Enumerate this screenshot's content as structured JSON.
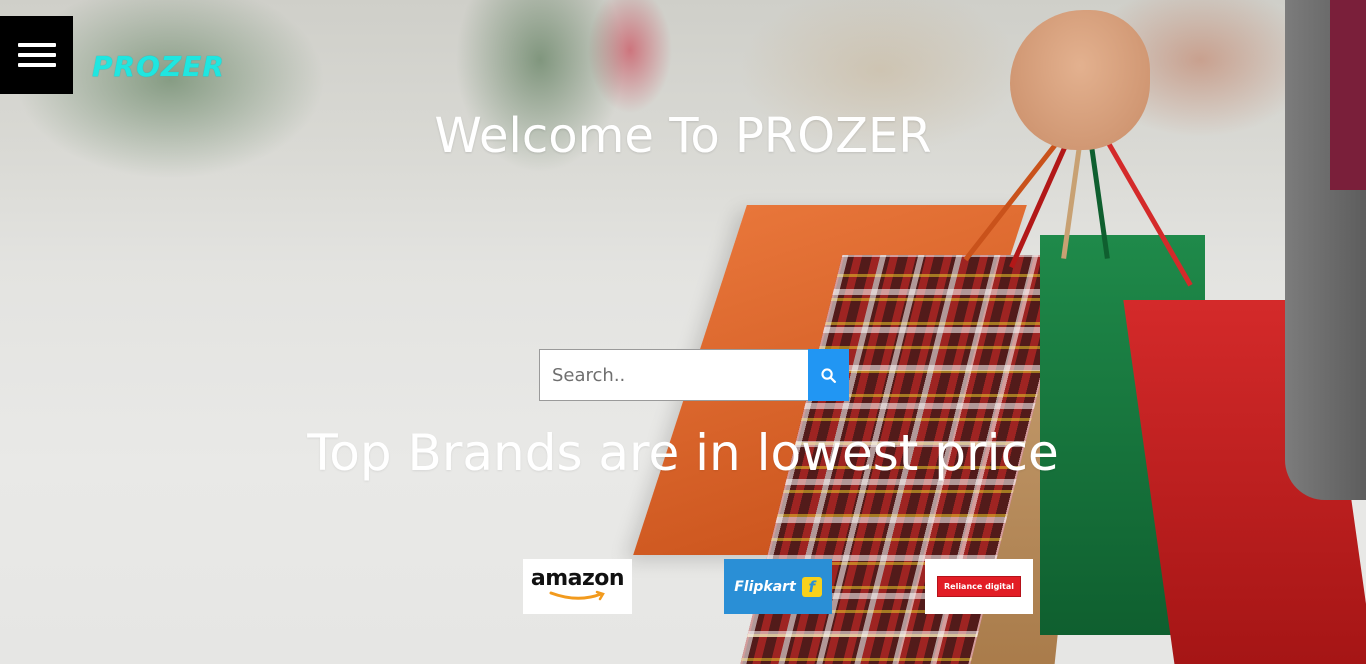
{
  "header": {
    "menu_icon": "hamburger-menu-icon",
    "logo_text": "PROZER",
    "logo_color": "#1fe6e0"
  },
  "hero": {
    "title": "Welcome To PROZER",
    "tagline": "Top Brands are in lowest price"
  },
  "search": {
    "placeholder": "Search..",
    "value": "",
    "button_icon": "search-icon",
    "button_color": "#2196f3"
  },
  "brands": [
    {
      "name": "amazon",
      "label": "amazon"
    },
    {
      "name": "flipkart",
      "label": "Flipkart",
      "badge": "f"
    },
    {
      "name": "reliance-digital",
      "label": "Reliance digital"
    }
  ]
}
